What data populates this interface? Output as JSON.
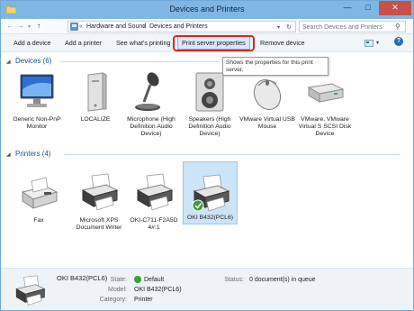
{
  "window": {
    "title": "Devices and Printers",
    "minimize": "—",
    "maximize": "□",
    "close": "✕"
  },
  "address": {
    "back": "←",
    "forward": "→",
    "up": "↑",
    "history": "«",
    "crumbs": [
      "Hardware and Sound",
      "Devices and Printers"
    ],
    "separator": "›",
    "refresh": "↻",
    "search_placeholder": "Search Devices and Printers"
  },
  "commands": {
    "add_device": "Add a device",
    "add_printer": "Add a printer",
    "see_printing": "See what's printing",
    "print_server": "Print server properties",
    "remove_device": "Remove device",
    "help": "?"
  },
  "tooltip": "Shows the properties for this print server.",
  "devices_group": {
    "label": "Devices (6)"
  },
  "devices": [
    {
      "label": "Generic Non-PnP Monitor",
      "icon": "monitor-icon"
    },
    {
      "label": "LOCALIZE",
      "icon": "computer-tower-icon"
    },
    {
      "label": "Microphone (High Definition Audio Device)",
      "icon": "microphone-icon"
    },
    {
      "label": "Speakers (High Definition Audio Device)",
      "icon": "speaker-icon"
    },
    {
      "label": "VMware Virtual USB Mouse",
      "icon": "mouse-icon"
    },
    {
      "label": "VMware, VMware Virtual S SCSI Disk Device",
      "icon": "disk-drive-icon"
    }
  ],
  "printers_group": {
    "label": "Printers (4)"
  },
  "printers": [
    {
      "label": "Fax",
      "icon": "fax-icon"
    },
    {
      "label": "Microsoft XPS Document Writer",
      "icon": "printer-icon"
    },
    {
      "label": "OKI-C711-F2A5D 4#:1",
      "icon": "printer-icon"
    },
    {
      "label": "OKI B432(PCL6)",
      "icon": "printer-default-icon",
      "selected": true
    }
  ],
  "details": {
    "name": "OKI B432(PCL6)",
    "state_label": "State:",
    "state_value": "Default",
    "model_label": "Model:",
    "model_value": "OKI B432(PCL6)",
    "category_label": "Category:",
    "category_value": "Printer",
    "status_label": "Status:",
    "status_value": "0 document(s) in queue"
  },
  "colors": {
    "accent": "#2a6bb5",
    "selection": "#cce4f7",
    "highlight_ring": "#d7262a",
    "titlebar": "#7fb6e3"
  }
}
